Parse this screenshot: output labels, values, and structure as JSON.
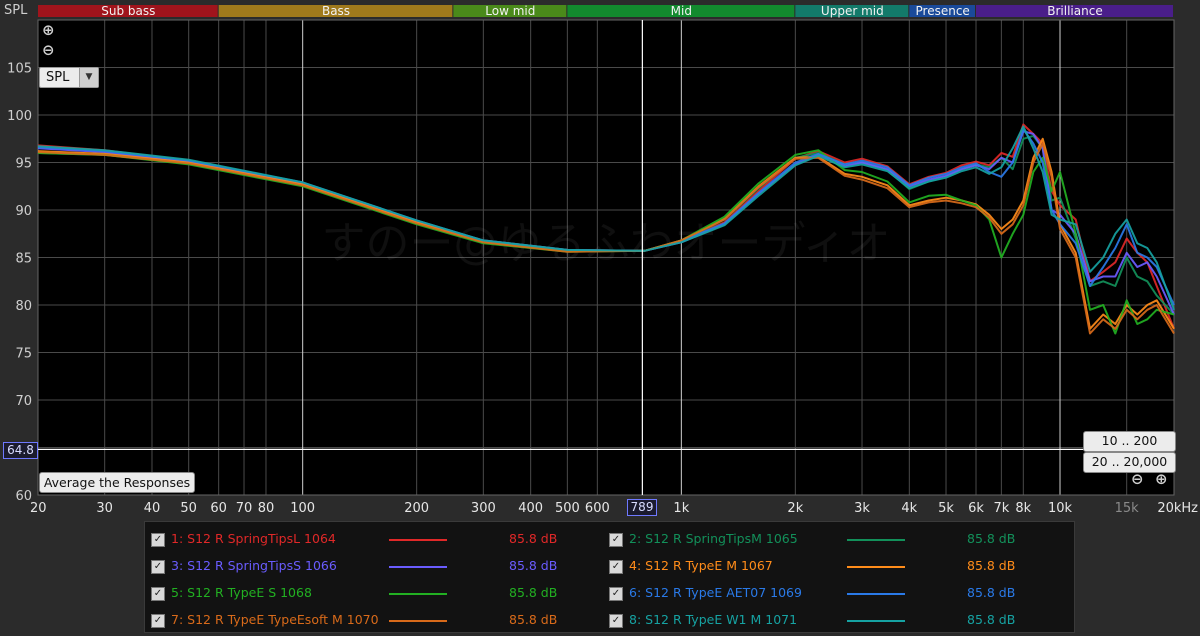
{
  "header": {
    "axis_title": "SPL"
  },
  "bands": [
    {
      "label": "Sub bass",
      "from": 20,
      "to": 60,
      "color": "#a0141c"
    },
    {
      "label": "Bass",
      "from": 60,
      "to": 250,
      "color": "#a07a1c"
    },
    {
      "label": "Low mid",
      "from": 250,
      "to": 500,
      "color": "#4a8a1a"
    },
    {
      "label": "Mid",
      "from": 500,
      "to": 2000,
      "color": "#128a2e"
    },
    {
      "label": "Upper mid",
      "from": 2000,
      "to": 4000,
      "color": "#137a6a"
    },
    {
      "label": "Presence",
      "from": 4000,
      "to": 6000,
      "color": "#1a4a9a"
    },
    {
      "label": "Brilliance",
      "from": 6000,
      "to": 20000,
      "color": "#4a1e8a"
    }
  ],
  "controls": {
    "spl_select": "SPL",
    "zoom_in": "⊕",
    "zoom_out": "⊖",
    "average_button": "Average the Responses",
    "range_10_200": "10 .. 200",
    "range_20_20000": "20 .. 20,000",
    "cursor_level": "64.8",
    "cursor_freq": "789"
  },
  "watermark": "すのー@ゆるふわオーディオ",
  "legend": [
    {
      "label": "1: S12 R SpringTipsL 1064",
      "value": "85.8 dB",
      "color": "#e02828"
    },
    {
      "label": "2: S12 R SpringTipsM 1065",
      "value": "85.8 dB",
      "color": "#12905a"
    },
    {
      "label": "3: S12 R SpringTipsS 1066",
      "value": "85.8 dB",
      "color": "#6a5cff"
    },
    {
      "label": "4: S12 R TypeE M 1067",
      "value": "85.8 dB",
      "color": "#ff8c1a"
    },
    {
      "label": "5: S12 R TypeE S 1068",
      "value": "85.8 dB",
      "color": "#22b022"
    },
    {
      "label": "6: S12 R TypeE AET07 1069",
      "value": "85.8 dB",
      "color": "#2a7ae8"
    },
    {
      "label": "7: S12 R TypeE TypeEsoft M 1070",
      "value": "85.8 dB",
      "color": "#d86a1a"
    },
    {
      "label": "8: S12 R TypeE W1 M 1071",
      "value": "85.8 dB",
      "color": "#16a2a2"
    }
  ],
  "chart_data": {
    "type": "line",
    "title": "",
    "xlabel": "",
    "ylabel": "SPL",
    "x_scale": "log",
    "xlim": [
      20,
      20000
    ],
    "ylim": [
      60,
      110
    ],
    "grid": true,
    "x_ticks": [
      20,
      30,
      40,
      50,
      60,
      70,
      80,
      100,
      200,
      300,
      400,
      500,
      600,
      1000,
      2000,
      3000,
      4000,
      5000,
      6000,
      7000,
      8000,
      10000,
      15000,
      20000
    ],
    "x_tick_labels": [
      "20",
      "30",
      "40",
      "50",
      "60",
      "70",
      "80",
      "100",
      "200",
      "300",
      "400",
      "500",
      "600",
      "1k",
      "2k",
      "3k",
      "4k",
      "5k",
      "6k",
      "7k",
      "8k",
      "10k",
      "15k",
      "20kHz"
    ],
    "x_tick_faint": [
      15000
    ],
    "y_ticks": [
      60,
      65,
      70,
      75,
      80,
      85,
      90,
      95,
      100,
      105
    ],
    "y_tick_labels": [
      "60",
      "65",
      "70",
      "75",
      "80",
      "85",
      "90",
      "95",
      "100",
      "105"
    ],
    "cursor": {
      "freq": 789,
      "level": 64.8
    },
    "x": [
      20,
      30,
      50,
      100,
      200,
      300,
      500,
      800,
      1000,
      1300,
      1600,
      2000,
      2300,
      2700,
      3000,
      3500,
      4000,
      4500,
      5000,
      5500,
      6000,
      6500,
      7000,
      7500,
      8000,
      8500,
      9000,
      9500,
      10000,
      11000,
      12000,
      13000,
      14000,
      15000,
      16000,
      17000,
      18000,
      20000
    ],
    "series": [
      {
        "name": "1: S12 R SpringTipsL 1064",
        "color": "#e02828",
        "values": [
          96.8,
          96.3,
          95.2,
          92.8,
          88.8,
          86.8,
          85.8,
          85.7,
          86.7,
          88.7,
          92.0,
          95.4,
          96.2,
          95.0,
          95.4,
          94.6,
          92.7,
          93.5,
          93.9,
          94.7,
          95.1,
          94.7,
          96.0,
          95.6,
          99.0,
          98.0,
          97.0,
          92.0,
          90.5,
          89.0,
          82.5,
          83.5,
          84.5,
          87.0,
          85.5,
          84.5,
          82.0,
          77.5
        ]
      },
      {
        "name": "2: S12 R SpringTipsM 1065",
        "color": "#12905a",
        "values": [
          96.0,
          95.8,
          94.9,
          92.6,
          88.6,
          86.6,
          85.7,
          85.7,
          86.7,
          89.0,
          92.3,
          95.5,
          96.0,
          94.8,
          95.0,
          94.2,
          92.2,
          93.0,
          93.5,
          94.3,
          94.8,
          94.5,
          95.5,
          94.3,
          97.5,
          97.8,
          96.5,
          91.0,
          91.3,
          87.0,
          82.0,
          82.5,
          82.0,
          85.0,
          83.0,
          82.5,
          81.0,
          79.0
        ]
      },
      {
        "name": "3: S12 R SpringTipsS 1066",
        "color": "#6a5cff",
        "values": [
          96.5,
          96.1,
          95.1,
          92.8,
          88.8,
          86.6,
          85.7,
          85.7,
          86.6,
          88.5,
          91.7,
          94.8,
          95.8,
          94.6,
          95.0,
          94.3,
          92.5,
          93.2,
          93.6,
          94.3,
          94.7,
          94.3,
          95.5,
          95.0,
          98.3,
          98.0,
          96.5,
          90.0,
          89.5,
          87.5,
          82.5,
          83.0,
          83.0,
          85.5,
          84.0,
          84.5,
          83.0,
          79.0
        ]
      },
      {
        "name": "4: S12 R TypeE M 1067",
        "color": "#ff8c1a",
        "values": [
          96.2,
          95.9,
          95.0,
          92.7,
          88.7,
          86.7,
          85.7,
          85.7,
          86.8,
          89.1,
          92.5,
          95.5,
          95.6,
          93.8,
          93.5,
          92.6,
          90.5,
          91.0,
          91.3,
          91.0,
          90.6,
          89.5,
          88.0,
          89.0,
          91.0,
          95.5,
          97.5,
          94.0,
          88.5,
          85.5,
          77.5,
          79.0,
          78.0,
          80.0,
          79.0,
          80.0,
          80.5,
          77.5
        ]
      },
      {
        "name": "5: S12 R TypeE S 1068",
        "color": "#22b022",
        "values": [
          96.0,
          95.8,
          94.8,
          92.5,
          88.5,
          86.5,
          85.6,
          85.7,
          86.8,
          89.3,
          92.8,
          95.8,
          96.3,
          94.2,
          94.0,
          93.0,
          90.8,
          91.5,
          91.6,
          91.0,
          90.5,
          89.0,
          85.0,
          87.5,
          89.5,
          94.0,
          95.5,
          92.0,
          94.0,
          87.5,
          79.5,
          80.0,
          77.0,
          80.5,
          78.0,
          78.5,
          79.5,
          79.0
        ]
      },
      {
        "name": "6: S12 R TypeE AET07 1069",
        "color": "#2a7ae8",
        "values": [
          96.6,
          96.2,
          95.2,
          92.9,
          88.9,
          86.8,
          85.8,
          85.7,
          86.7,
          88.6,
          91.8,
          95.0,
          95.9,
          94.8,
          95.2,
          94.5,
          92.6,
          93.4,
          93.8,
          94.5,
          94.9,
          94.0,
          93.5,
          95.0,
          98.5,
          97.0,
          95.0,
          90.0,
          88.5,
          86.5,
          82.0,
          84.0,
          86.0,
          88.5,
          85.5,
          85.0,
          84.0,
          80.0
        ]
      },
      {
        "name": "7: S12 R TypeE TypeEsoft M 1070",
        "color": "#d86a1a",
        "values": [
          96.1,
          95.8,
          94.9,
          92.6,
          88.6,
          86.6,
          85.6,
          85.7,
          86.8,
          89.0,
          92.4,
          95.4,
          95.5,
          93.6,
          93.2,
          92.3,
          90.3,
          90.8,
          91.0,
          90.7,
          90.3,
          89.2,
          87.5,
          88.5,
          90.5,
          95.0,
          97.0,
          93.5,
          88.0,
          85.0,
          77.0,
          78.5,
          77.5,
          79.5,
          78.5,
          79.5,
          80.0,
          77.0
        ]
      },
      {
        "name": "8: S12 R TypeE W1 M 1071",
        "color": "#16a2a2",
        "values": [
          96.7,
          96.3,
          95.3,
          92.9,
          88.9,
          86.8,
          85.8,
          85.7,
          86.6,
          88.4,
          91.5,
          94.7,
          95.7,
          94.5,
          94.8,
          94.1,
          92.3,
          93.0,
          93.4,
          94.1,
          94.5,
          93.8,
          94.5,
          96.5,
          98.8,
          96.5,
          94.0,
          89.5,
          89.0,
          88.5,
          83.5,
          85.0,
          87.5,
          89.0,
          86.5,
          86.0,
          84.5,
          79.5
        ]
      }
    ]
  }
}
